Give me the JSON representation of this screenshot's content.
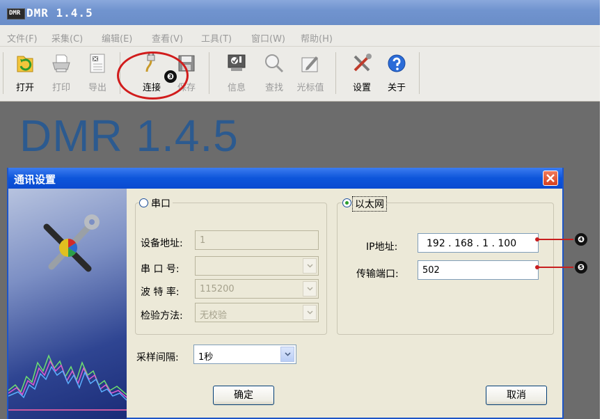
{
  "window": {
    "title": "DMR 1.4.5",
    "icon_text": "DMR"
  },
  "menubar": {
    "items": [
      "文件(F)",
      "采集(C)",
      "编辑(E)",
      "查看(V)",
      "工具(T)",
      "窗口(W)",
      "帮助(H)"
    ]
  },
  "toolbar": {
    "buttons": [
      {
        "label": "打开",
        "icon": "open-folder-icon",
        "enabled": true
      },
      {
        "label": "打印",
        "icon": "printer-icon",
        "enabled": false
      },
      {
        "label": "导出",
        "icon": "export-icon",
        "enabled": false
      },
      {
        "label": "连接",
        "icon": "connect-plug-icon",
        "enabled": true
      },
      {
        "label": "保存",
        "icon": "save-disk-icon",
        "enabled": false
      },
      {
        "label": "信息",
        "icon": "info-icon",
        "enabled": false
      },
      {
        "label": "查找",
        "icon": "magnifier-icon",
        "enabled": false
      },
      {
        "label": "光标值",
        "icon": "cursor-value-icon",
        "enabled": false
      },
      {
        "label": "设置",
        "icon": "tools-icon",
        "enabled": true
      },
      {
        "label": "关于",
        "icon": "help-icon",
        "enabled": true
      }
    ]
  },
  "banner": {
    "text": "DMR 1.4.5"
  },
  "annotations": {
    "connect": "❸",
    "ip": "❹",
    "port": "❺"
  },
  "dialog": {
    "title": "通讯设置",
    "serial": {
      "legend": "串口",
      "selected": false,
      "device_address_label": "设备地址:",
      "device_address_value": "1",
      "port_label": "串 口 号:",
      "port_value": "",
      "baud_label": "波 特 率:",
      "baud_value": "115200",
      "parity_label": "检验方法:",
      "parity_value": "无校验"
    },
    "ethernet": {
      "legend": "以太网",
      "selected": true,
      "ip_label": "IP地址:",
      "ip_value": "192 . 168 . 1 . 100",
      "port_label": "传输端口:",
      "port_value": "502"
    },
    "sampling": {
      "label": "采样间隔:",
      "value": "1秒"
    },
    "ok_label": "确定",
    "cancel_label": "取消"
  },
  "colors": {
    "title_bar": "#6a8dc8",
    "dialog_title": "#0d55da",
    "annotation_red": "#d11c1c",
    "banner": "#2c5a8f"
  }
}
